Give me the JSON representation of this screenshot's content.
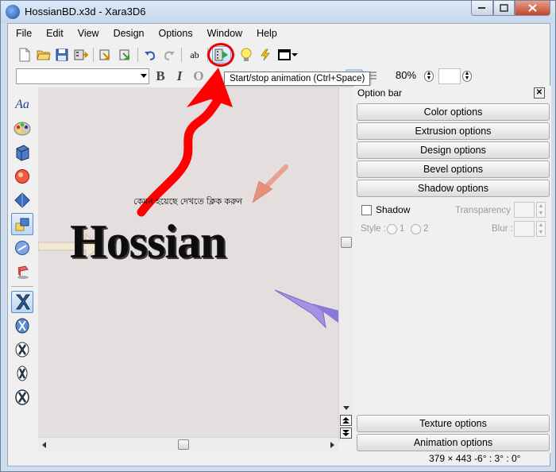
{
  "window": {
    "title": "HossianBD.x3d - Xara3D6"
  },
  "menubar": {
    "items": [
      "File",
      "Edit",
      "View",
      "Design",
      "Options",
      "Window",
      "Help"
    ]
  },
  "toolbar": {
    "icons": [
      "new-document-icon",
      "open-folder-icon",
      "save-icon",
      "export-icon",
      "import-icon",
      "export-animation-icon",
      "undo-icon",
      "redo-icon",
      "text-edit-icon",
      "animation-icon",
      "light-bulb-icon",
      "lightning-icon",
      "window-icon"
    ],
    "text_tool_label": "ab",
    "tooltip": "Start/stop animation (Ctrl+Space)"
  },
  "format_bar": {
    "font_value": "",
    "bold_label": "B",
    "italic_label": "I",
    "outline_label": "O",
    "zoom_value": "80%"
  },
  "left_tools": [
    "text-style-icon",
    "color-palette-icon",
    "extrude-icon",
    "bevel-icon",
    "lighting-icon",
    "arrange-icon",
    "rotate-icon",
    "shadow-icon",
    "texture-x-icon",
    "animation-x-icon",
    "wave-x-icon",
    "fade-x-icon",
    "spin-x-icon"
  ],
  "left_tools_label": "Aa",
  "canvas": {
    "bengali_text": "কেমন হয়েছে দেখতে ক্লিক করুন",
    "main_text": "Hossian"
  },
  "option_bar": {
    "title": "Option bar",
    "close_label": "✕",
    "buttons": [
      "Color options",
      "Extrusion options",
      "Design options",
      "Bevel options",
      "Shadow options"
    ],
    "shadow": {
      "checkbox_label": "Shadow",
      "checked": false,
      "transparency_label": "Transparency :",
      "style_label": "Style :",
      "style_options": [
        "1",
        "2"
      ],
      "blur_label": "Blur :"
    },
    "bottom_buttons": [
      "Texture options",
      "Animation options"
    ]
  },
  "status": {
    "text": "379 × 443 -6° : 3° : 0°"
  },
  "colors": {
    "highlight_red": "#e00000",
    "canvas_bg": "#e5dede",
    "arrow_purple": "#a493e0",
    "arrow_salmon": "#eaa18e",
    "arrow_cream": "#f3e7d3"
  }
}
